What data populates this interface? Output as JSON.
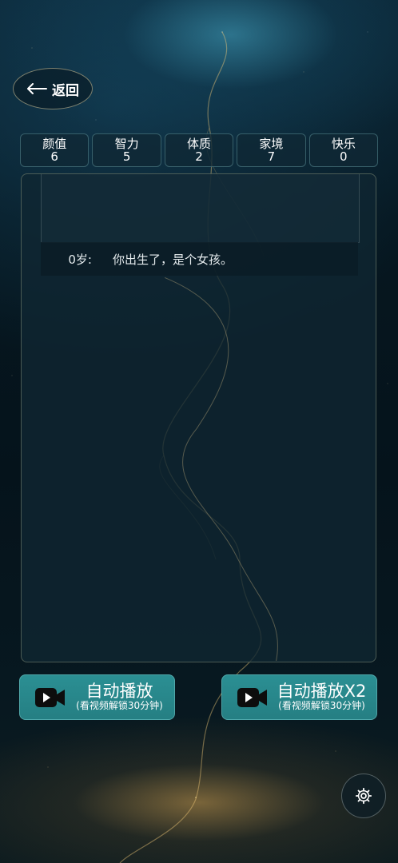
{
  "header": {
    "back_label": "返回"
  },
  "stats": [
    {
      "name": "颜值",
      "value": "6"
    },
    {
      "name": "智力",
      "value": "5"
    },
    {
      "name": "体质",
      "value": "2"
    },
    {
      "name": "家境",
      "value": "7"
    },
    {
      "name": "快乐",
      "value": "0"
    }
  ],
  "events": [
    {
      "age": "0岁:",
      "text": "你出生了，是个女孩。"
    }
  ],
  "buttons": {
    "auto_play": {
      "label": "自动播放",
      "sub": "(看视频解锁30分钟)"
    },
    "auto_play_x2": {
      "label": "自动播放X2",
      "sub": "(看视频解锁30分钟)"
    }
  },
  "icons": {
    "back": "arrow-left-icon",
    "video": "video-camera-icon",
    "settings": "gear-icon"
  },
  "colors": {
    "button_teal": "#2b8f93",
    "panel_bg": "#0f2632",
    "text": "#ffffff"
  }
}
